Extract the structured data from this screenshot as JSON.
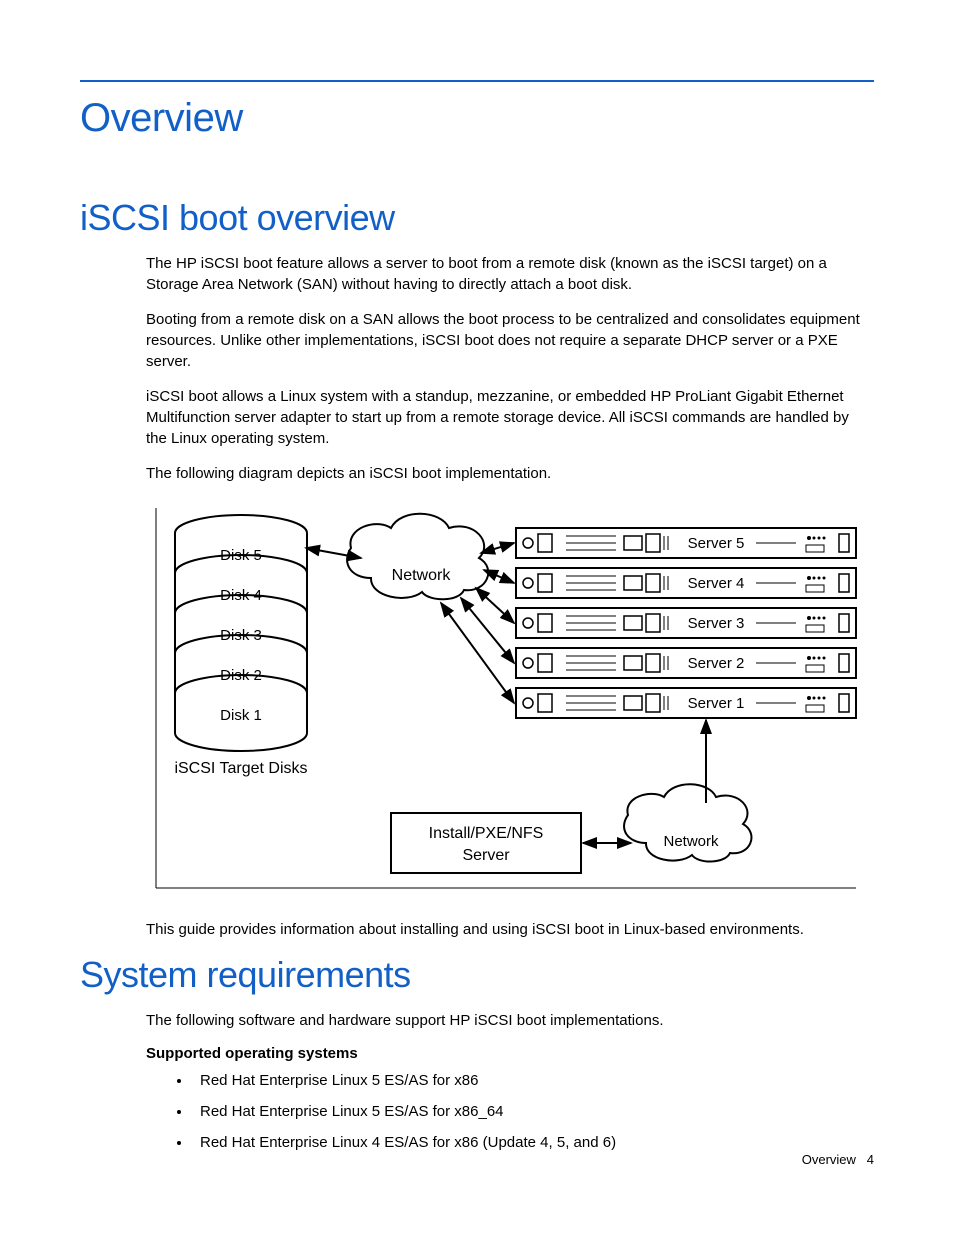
{
  "page_title": "Overview",
  "sections": {
    "iscsi": {
      "heading": "iSCSI boot overview",
      "p1": "The HP iSCSI boot feature allows a server to boot from a remote disk (known as the iSCSI target) on a Storage Area Network (SAN) without having to directly attach a boot disk.",
      "p2": "Booting from a remote disk on a SAN allows the boot process to be centralized and consolidates equipment resources. Unlike other implementations, iSCSI boot does not require a separate DHCP server or a PXE server.",
      "p3": "iSCSI boot allows a Linux system with a standup, mezzanine, or embedded HP ProLiant Gigabit Ethernet Multifunction server adapter to start up from a remote storage device. All iSCSI commands are handled by the Linux operating system.",
      "p4": "The following diagram depicts an iSCSI boot implementation.",
      "p5": "This guide provides information about installing and using iSCSI boot in Linux-based environments."
    },
    "sysreq": {
      "heading": "System requirements",
      "p1": "The following software and hardware support HP iSCSI boot implementations.",
      "subhead": "Supported operating systems",
      "items": [
        "Red Hat Enterprise Linux 5 ES/AS for x86",
        "Red Hat Enterprise Linux 5 ES/AS for x86_64",
        "Red Hat Enterprise Linux 4 ES/AS for x86 (Update 4, 5, and 6)"
      ]
    }
  },
  "diagram": {
    "disks": [
      "Disk 5",
      "Disk 4",
      "Disk 3",
      "Disk 2",
      "Disk 1"
    ],
    "disks_label": "iSCSI Target Disks",
    "network_top": "Network",
    "network_bottom": "Network",
    "install_box_l1": "Install/PXE/NFS",
    "install_box_l2": "Server",
    "servers": [
      "Server 5",
      "Server 4",
      "Server 3",
      "Server 2",
      "Server 1"
    ]
  },
  "footer": {
    "section": "Overview",
    "page_no": "4"
  }
}
